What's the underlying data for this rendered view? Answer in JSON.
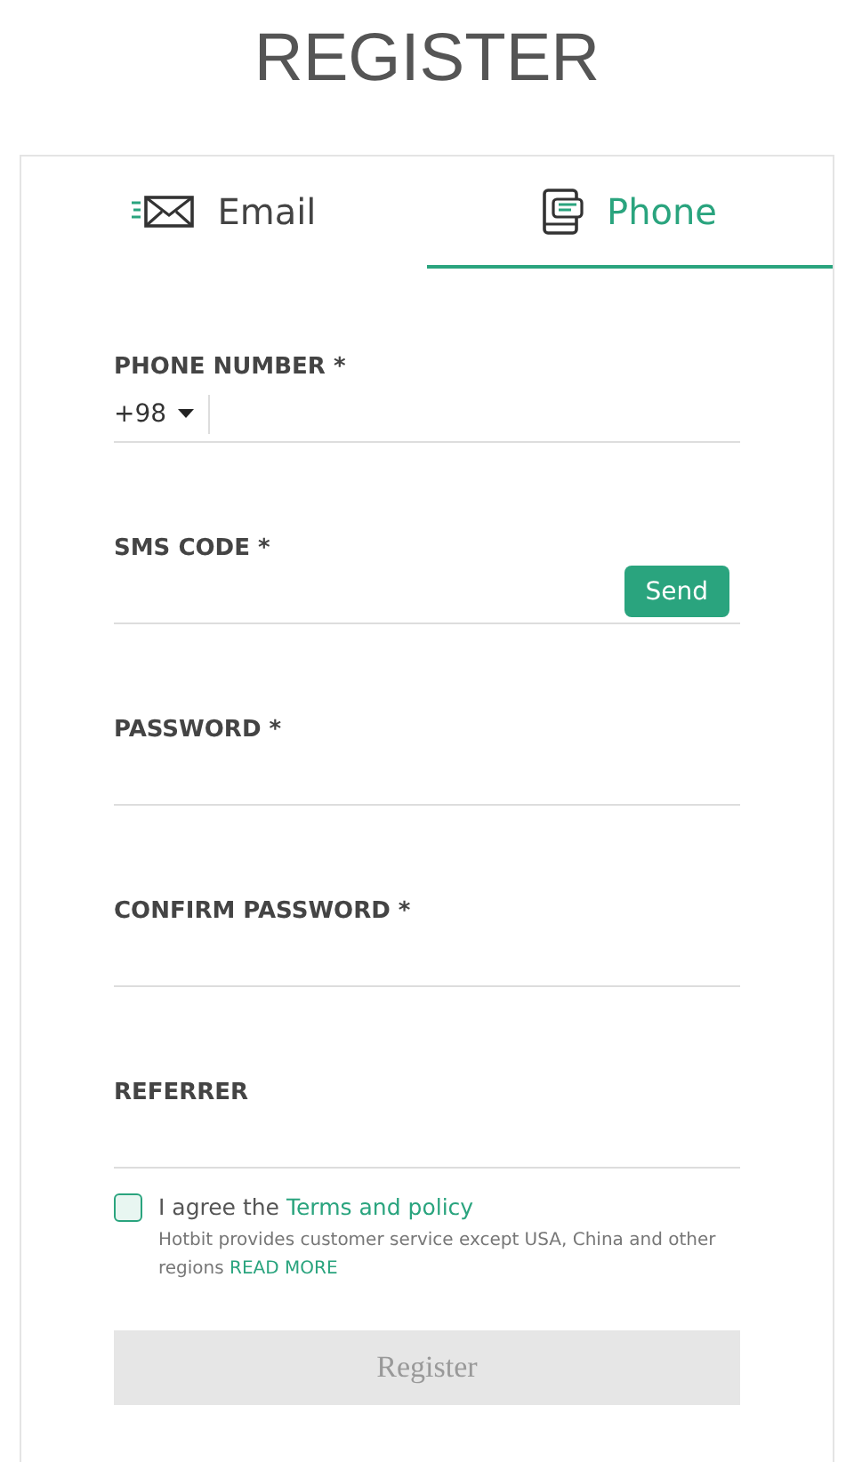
{
  "title": "REGISTER",
  "tabs": [
    {
      "label": "Email",
      "kind": "email",
      "selected": false
    },
    {
      "label": "Phone",
      "kind": "phone",
      "selected": true
    }
  ],
  "fields": [
    {
      "label": "PHONE NUMBER *",
      "kind": "phone",
      "country_code": "+98"
    },
    {
      "label": "SMS CODE *",
      "kind": "sms",
      "button": "Send"
    },
    {
      "label": "PASSWORD *",
      "kind": "text"
    },
    {
      "label": "CONFIRM PASSWORD *",
      "kind": "text"
    },
    {
      "label": "REFERRER",
      "kind": "text"
    }
  ],
  "agreement": {
    "checked": false,
    "text": "I agree the",
    "link": "Terms and policy",
    "note": "Hotbit provides customer service except USA, China and other regions",
    "note_link": "READ MORE"
  },
  "submit": {
    "label": "Register",
    "disabled": true
  }
}
